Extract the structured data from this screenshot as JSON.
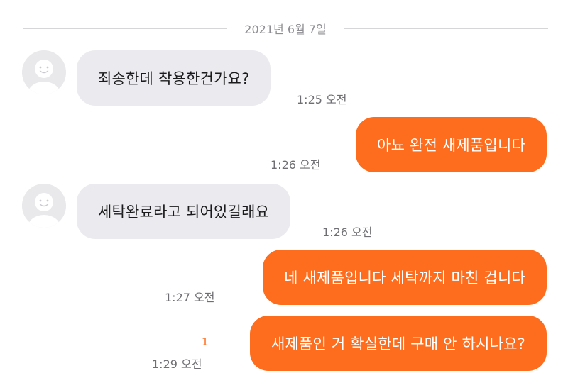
{
  "date_separator": "2021년 6월 7일",
  "messages": [
    {
      "direction": "in",
      "text": "죄송한데 착용한건가요?",
      "time": "1:25 오전"
    },
    {
      "direction": "out",
      "text": "아뇨 완전 새제품입니다",
      "time": "1:26 오전"
    },
    {
      "direction": "in",
      "text": "세탁완료라고 되어있길래요",
      "time": "1:26 오전"
    },
    {
      "direction": "out",
      "text": "네 새제품입니다 세탁까지 마친 겁니다",
      "time": "1:27 오전"
    },
    {
      "direction": "out",
      "text": "새제품인 거 확실한데 구매 안 하시나요?",
      "time": "1:29 오전",
      "unread_count": "1"
    }
  ],
  "colors": {
    "outgoing_bubble": "#fe6d1e",
    "incoming_bubble": "#ebebef",
    "unread_indicator": "#fe6d1e"
  },
  "icons": {
    "avatar": "default-profile-icon"
  }
}
